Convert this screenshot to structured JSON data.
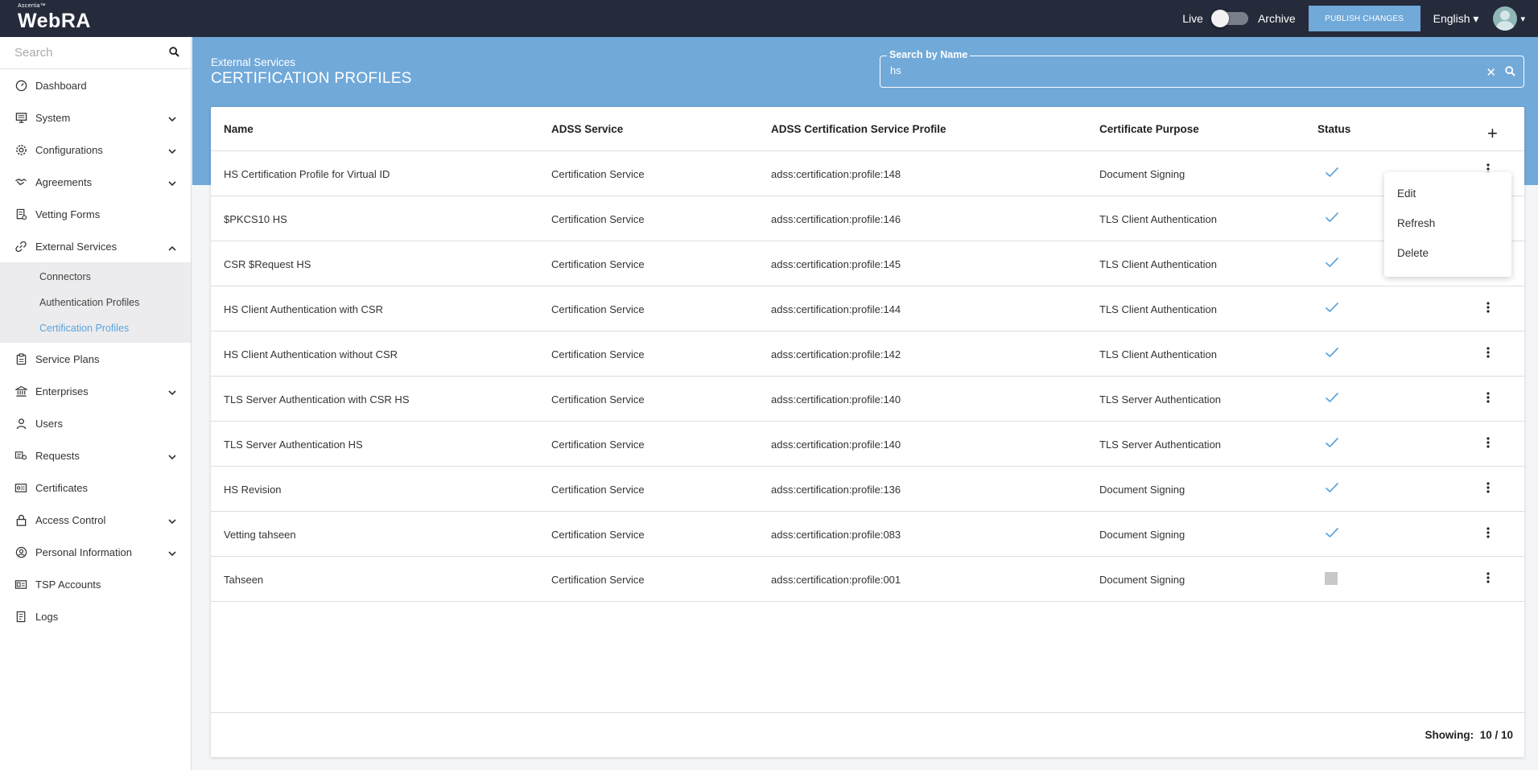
{
  "app": {
    "brand_small": "Ascertia™",
    "brand_name": "WebRA"
  },
  "topbar": {
    "live_label": "Live",
    "archive_label": "Archive",
    "publish_label": "PUBLISH CHANGES",
    "language": "English ▾",
    "avatar_caret": "▾"
  },
  "sidebar": {
    "search_placeholder": "Search",
    "items": [
      {
        "label": "Dashboard",
        "icon": "dashboard-icon",
        "expand": ""
      },
      {
        "label": "System",
        "icon": "monitor-icon",
        "expand": "down"
      },
      {
        "label": "Configurations",
        "icon": "gear-icon",
        "expand": "down"
      },
      {
        "label": "Agreements",
        "icon": "handshake-icon",
        "expand": "down"
      },
      {
        "label": "Vetting Forms",
        "icon": "form-icon",
        "expand": ""
      },
      {
        "label": "External Services",
        "icon": "link-icon",
        "expand": "up"
      }
    ],
    "sub_items": [
      {
        "label": "Connectors"
      },
      {
        "label": "Authentication Profiles"
      },
      {
        "label": "Certification Profiles"
      }
    ],
    "items_after": [
      {
        "label": "Service Plans",
        "icon": "clipboard-icon",
        "expand": ""
      },
      {
        "label": "Enterprises",
        "icon": "bank-icon",
        "expand": "down"
      },
      {
        "label": "Users",
        "icon": "user-icon",
        "expand": ""
      },
      {
        "label": "Requests",
        "icon": "request-icon",
        "expand": "down"
      },
      {
        "label": "Certificates",
        "icon": "certificate-icon",
        "expand": ""
      },
      {
        "label": "Access Control",
        "icon": "lock-icon",
        "expand": "down"
      },
      {
        "label": "Personal Information",
        "icon": "person-circle-icon",
        "expand": "down"
      },
      {
        "label": "TSP Accounts",
        "icon": "id-card-icon",
        "expand": ""
      },
      {
        "label": "Logs",
        "icon": "log-icon",
        "expand": ""
      }
    ]
  },
  "header": {
    "breadcrumb": "External Services",
    "title": "CERTIFICATION PROFILES",
    "search_legend": "Search by Name",
    "search_value": "hs",
    "clear_glyph": "✕"
  },
  "table": {
    "columns": [
      "Name",
      "ADSS Service",
      "ADSS Certification Service Profile",
      "Certificate Purpose",
      "Status"
    ],
    "add_glyph": "+",
    "rows": [
      {
        "name": "HS Certification Profile for Virtual ID",
        "service": "Certification Service",
        "profile": "adss:certification:profile:148",
        "purpose": "Document Signing",
        "status": "active"
      },
      {
        "name": "$PKCS10 HS",
        "service": "Certification Service",
        "profile": "adss:certification:profile:146",
        "purpose": "TLS Client Authentication",
        "status": "active"
      },
      {
        "name": "CSR $Request HS",
        "service": "Certification Service",
        "profile": "adss:certification:profile:145",
        "purpose": "TLS Client Authentication",
        "status": "active"
      },
      {
        "name": "HS Client Authentication with CSR",
        "service": "Certification Service",
        "profile": "adss:certification:profile:144",
        "purpose": "TLS Client Authentication",
        "status": "active"
      },
      {
        "name": "HS Client Authentication without CSR",
        "service": "Certification Service",
        "profile": "adss:certification:profile:142",
        "purpose": "TLS Client Authentication",
        "status": "active"
      },
      {
        "name": "TLS Server Authentication with CSR HS",
        "service": "Certification Service",
        "profile": "adss:certification:profile:140",
        "purpose": "TLS Server Authentication",
        "status": "active"
      },
      {
        "name": "TLS Server Authentication HS",
        "service": "Certification Service",
        "profile": "adss:certification:profile:140",
        "purpose": "TLS Server Authentication",
        "status": "active"
      },
      {
        "name": "HS Revision",
        "service": "Certification Service",
        "profile": "adss:certification:profile:136",
        "purpose": "Document Signing",
        "status": "active"
      },
      {
        "name": "Vetting tahseen",
        "service": "Certification Service",
        "profile": "adss:certification:profile:083",
        "purpose": "Document Signing",
        "status": "active"
      },
      {
        "name": "Tahseen",
        "service": "Certification Service",
        "profile": "adss:certification:profile:001",
        "purpose": "Document Signing",
        "status": "inactive"
      }
    ],
    "showing_label": "Showing:",
    "showing_value": "10 / 10"
  },
  "context_menu": {
    "items": [
      "Edit",
      "Refresh",
      "Delete"
    ]
  },
  "colors": {
    "topbar": "#252b3b",
    "accent": "#71a9d9",
    "active_link": "#5ba3dc",
    "check": "#5ba3dc"
  }
}
